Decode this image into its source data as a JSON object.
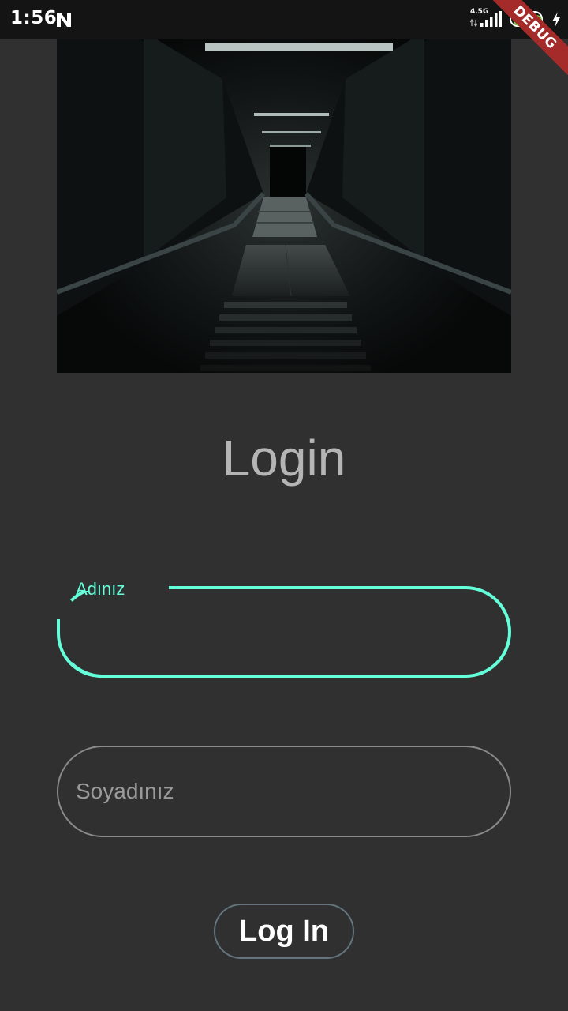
{
  "status_bar": {
    "time": "1:56",
    "network_type": "4.5G",
    "battery_level": "100",
    "battery_color": "#6fd23a"
  },
  "debug_banner": {
    "label": "DEBUG",
    "color": "#a52a2a"
  },
  "hero_image": {
    "description_icon": "dark-stairway-image"
  },
  "login": {
    "title": "Login",
    "first_name_field": {
      "label": "Adınız",
      "value": "",
      "state": "focused"
    },
    "last_name_field": {
      "placeholder": "Soyadınız",
      "value": ""
    },
    "submit_label": "Log In"
  },
  "colors": {
    "background": "#303030",
    "accent": "#64ffda",
    "title": "#b5b5b5",
    "field_border": "#8a8a8a",
    "button_border": "#62747e"
  }
}
